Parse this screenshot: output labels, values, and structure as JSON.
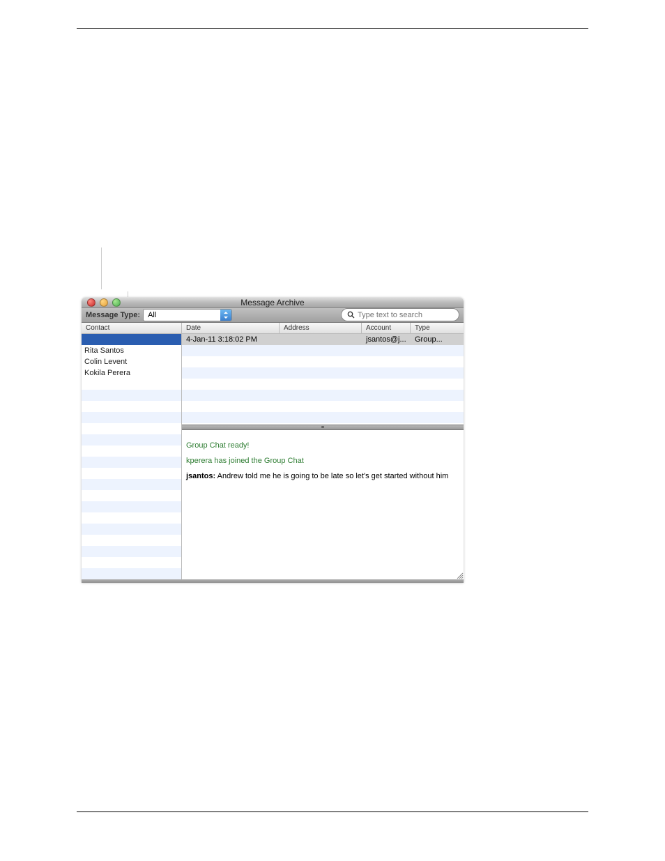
{
  "window": {
    "title": "Message Archive"
  },
  "toolbar": {
    "filter_label": "Message Type:",
    "filter_value": "All",
    "search_placeholder": "Type text to search"
  },
  "sidebar": {
    "header": "Contact",
    "contacts": [
      {
        "name": "",
        "selected": true
      },
      {
        "name": "Rita Santos"
      },
      {
        "name": "Colin Levent"
      },
      {
        "name": "Kokila Perera"
      }
    ]
  },
  "table": {
    "columns": {
      "date": "Date",
      "address": "Address",
      "account": "Account",
      "type": "Type"
    },
    "rows": [
      {
        "date": "4-Jan-11 3:18:02 PM",
        "address": "",
        "account": "jsantos@j...",
        "type": "Group..."
      }
    ]
  },
  "chat": {
    "lines": [
      {
        "style": "system-green",
        "text": "Group Chat ready!"
      },
      {
        "style": "system-green",
        "text": "kperera has joined the Group Chat"
      },
      {
        "style": "msg",
        "sender": "jsantos:",
        "text": " Andrew told me he is going to be late so let's get started without him"
      }
    ]
  }
}
